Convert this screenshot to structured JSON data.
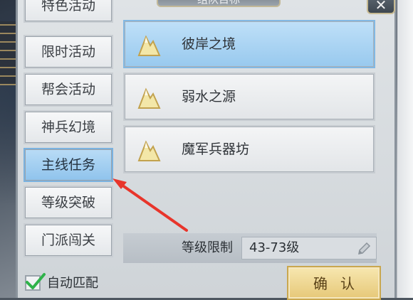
{
  "dialog": {
    "title": "组队目标",
    "close_label": "✕"
  },
  "tabs": [
    {
      "label": "特色活动",
      "selected": false
    },
    {
      "label": "限时活动",
      "selected": false
    },
    {
      "label": "帮会活动",
      "selected": false
    },
    {
      "label": "神兵幻境",
      "selected": false
    },
    {
      "label": "主线任务",
      "selected": true
    },
    {
      "label": "等级突破",
      "selected": false
    },
    {
      "label": "门派闯关",
      "selected": false
    }
  ],
  "targets": [
    {
      "label": "彼岸之境",
      "icon": "mountain-icon",
      "selected": true
    },
    {
      "label": "弱水之源",
      "icon": "mountain-icon",
      "selected": false
    },
    {
      "label": "魔军兵器坊",
      "icon": "mountain-icon",
      "selected": false
    }
  ],
  "level": {
    "label": "等级限制",
    "value": "43-73级",
    "edit_icon": "pencil-icon"
  },
  "auto_match": {
    "label": "自动匹配",
    "checked": true
  },
  "confirm_label": "确认",
  "colors": {
    "selected_blue": "#9fcdf0",
    "confirm_gold": "#ead08a",
    "arrow_red": "#e8352b",
    "check_green": "#2fb24a"
  }
}
